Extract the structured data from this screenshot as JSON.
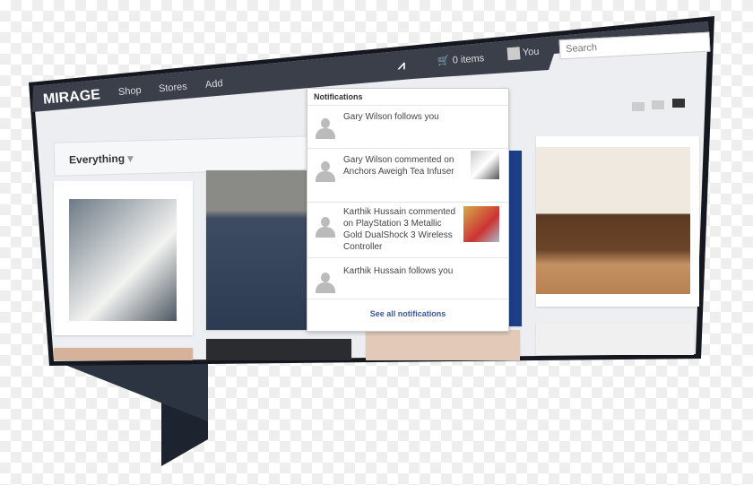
{
  "brand": "MIRAGE",
  "nav": {
    "items": [
      {
        "label": "Shop"
      },
      {
        "label": "Stores"
      },
      {
        "label": "Add"
      }
    ],
    "cart_label": "0 items",
    "user_label": "You",
    "search_placeholder": "Search"
  },
  "filter": {
    "label": "Everything"
  },
  "icons": [
    "activity-icon",
    "cart-icon",
    "user-icon",
    "search-icon",
    "list-view-icon",
    "grid-view-icon",
    "tile-view-icon",
    "chevron-down-icon"
  ],
  "notifications": {
    "title": "Notifications",
    "items": [
      {
        "text": "Gary Wilson follows you"
      },
      {
        "text": "Gary Wilson commented on Anchors Aweigh Tea Infuser"
      },
      {
        "text": "Karthik Hussain commented on PlayStation 3 Metallic Gold DualShock 3 Wireless Controller"
      },
      {
        "text": "Karthik Hussain follows you"
      }
    ],
    "see_all": "See all notifications"
  },
  "colors": {
    "navbar": "#3a3f4a",
    "frame": "#1b1f27",
    "content_bg": "#eceef1",
    "link": "#3b5998"
  }
}
